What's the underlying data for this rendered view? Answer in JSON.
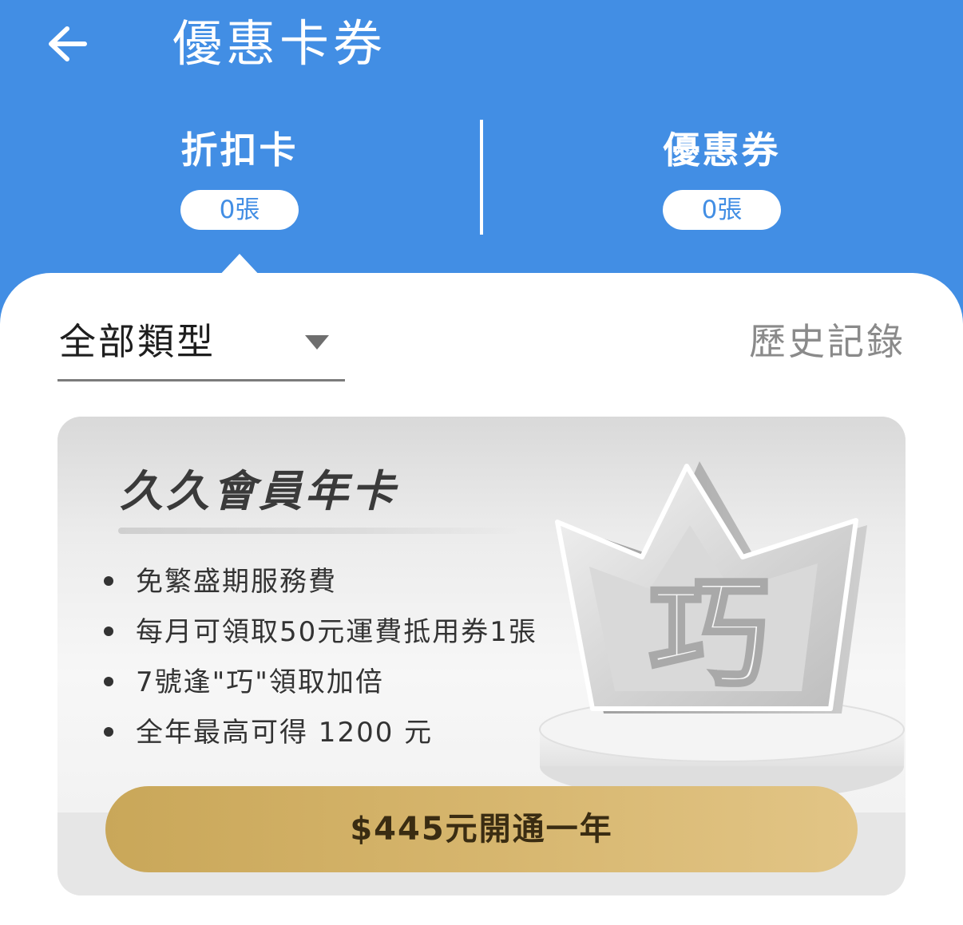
{
  "header": {
    "title": "優惠卡券",
    "back_icon": "arrow-left-icon"
  },
  "tabs": [
    {
      "label": "折扣卡",
      "count": "0張",
      "active": true
    },
    {
      "label": "優惠券",
      "count": "0張",
      "active": false
    }
  ],
  "filter": {
    "selected": "全部類型",
    "caret_icon": "caret-down-icon",
    "history_label": "歷史記錄"
  },
  "card": {
    "title": "久久會員年卡",
    "benefits": [
      "免繁盛期服務費",
      "每月可領取50元運費抵用券1張",
      "7號逢\"巧\"領取加倍",
      "全年最高可得 1200 元"
    ],
    "crown_glyph": "巧",
    "cta_label": "$445元開通一年"
  },
  "colors": {
    "header_bg": "#428ee4",
    "cta_gold_start": "#c9a759",
    "cta_gold_end": "#e2c586",
    "text_dark": "#1e1e1e",
    "text_muted": "#8a8a8a"
  }
}
